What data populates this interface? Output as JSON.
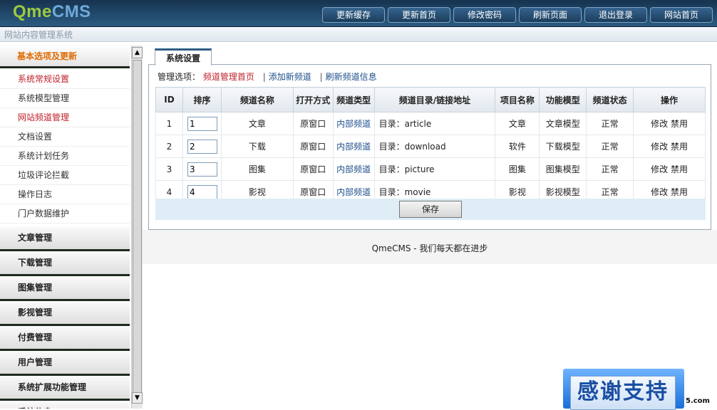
{
  "header": {
    "logo_qme": "Qme",
    "logo_cms": "CMS",
    "subtitle": "网站内容管理系统",
    "nav": [
      "更新缓存",
      "更新首页",
      "修改密码",
      "刷新页面",
      "退出登录",
      "网站首页"
    ]
  },
  "sidebar": {
    "active_section": "基本选项及更新",
    "sub_items": [
      {
        "label": "系统常规设置",
        "red": true
      },
      {
        "label": "系统模型管理",
        "red": false
      },
      {
        "label": "网站频道管理",
        "red": true
      },
      {
        "label": "文档设置",
        "red": false
      },
      {
        "label": "系统计划任务",
        "red": false
      },
      {
        "label": "垃圾评论拦截",
        "red": false
      },
      {
        "label": "操作日志",
        "red": false
      },
      {
        "label": "门户数据维护",
        "red": false
      }
    ],
    "groups": [
      "文章管理",
      "下载管理",
      "图集管理",
      "影视管理",
      "付费管理",
      "用户管理",
      "系统扩展功能管理",
      "系统信息"
    ]
  },
  "main": {
    "tab": "系统设置",
    "options_label": "管理选项：",
    "options_current": "频道管理首页",
    "options_links": [
      "添加新频道",
      "刷新频道信息"
    ],
    "table": {
      "headers": [
        "ID",
        "排序",
        "频道名称",
        "打开方式",
        "频道类型",
        "频道目录/链接地址",
        "项目名称",
        "功能模型",
        "频道状态",
        "操作"
      ],
      "rows": [
        {
          "id": "1",
          "order": "1",
          "name": "文章",
          "open": "原窗口",
          "type": "内部频道",
          "dir": "目录：article",
          "item": "文章",
          "model": "文章模型",
          "status": "正常",
          "ops": "修改 禁用"
        },
        {
          "id": "2",
          "order": "2",
          "name": "下载",
          "open": "原窗口",
          "type": "内部频道",
          "dir": "目录：download",
          "item": "软件",
          "model": "下载模型",
          "status": "正常",
          "ops": "修改 禁用"
        },
        {
          "id": "3",
          "order": "3",
          "name": "图集",
          "open": "原窗口",
          "type": "内部频道",
          "dir": "目录：picture",
          "item": "图集",
          "model": "图集模型",
          "status": "正常",
          "ops": "修改 禁用"
        },
        {
          "id": "4",
          "order": "4",
          "name": "影视",
          "open": "原窗口",
          "type": "内部频道",
          "dir": "目录：movie",
          "item": "影视",
          "model": "影视模型",
          "status": "正常",
          "ops": "修改 禁用"
        }
      ]
    },
    "save_label": "保存",
    "footer": "QmeCMS - 我们每天都在进步"
  },
  "badge": {
    "text": "感谢支持",
    "mark": "5.com"
  },
  "colors": {
    "header_bg": "#1f4667",
    "accent_orange": "#e06a00",
    "link_red": "#c0212a",
    "link_blue": "#1e4f8c"
  }
}
